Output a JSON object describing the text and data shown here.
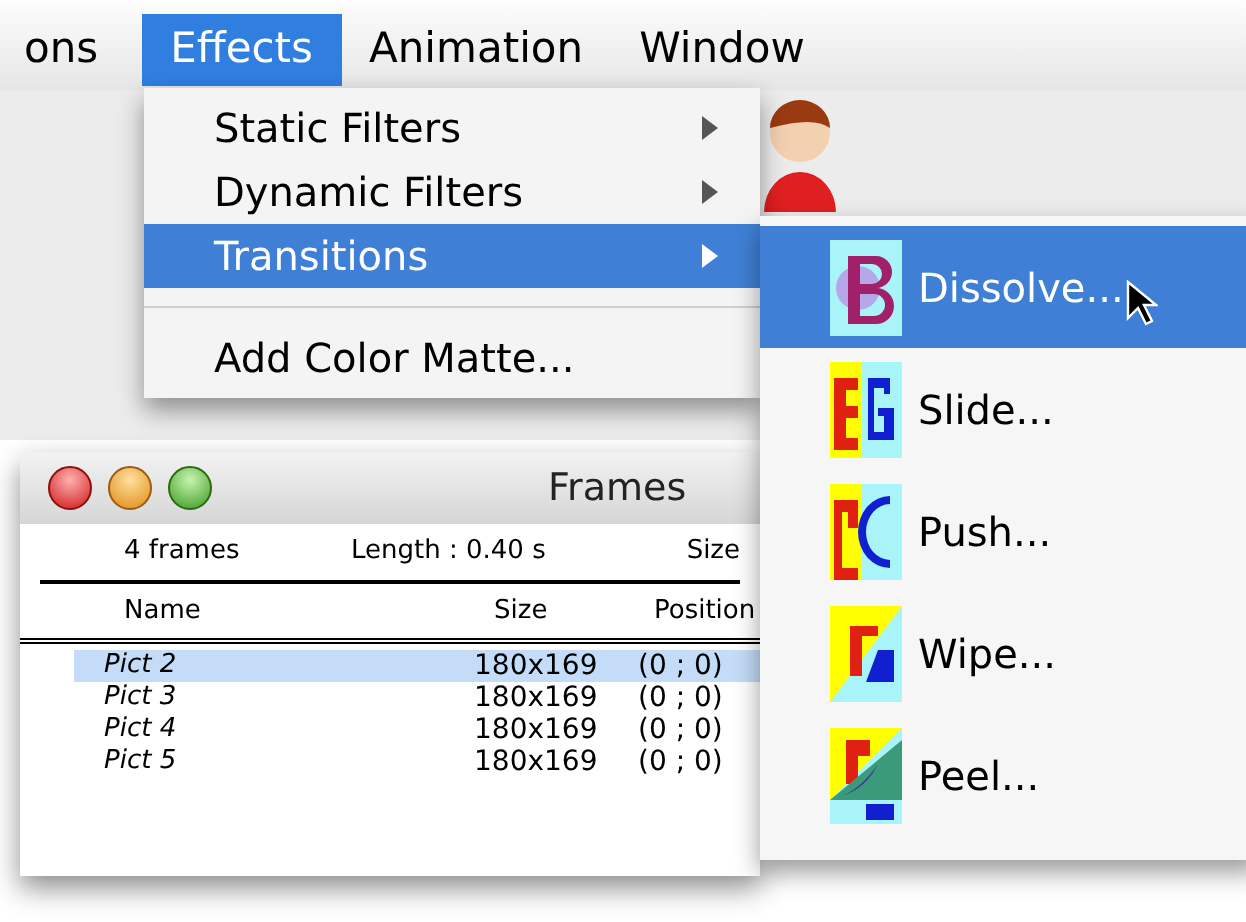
{
  "menu_bar": {
    "items": [
      {
        "label": "ons",
        "selected": false
      },
      {
        "label": "Effects",
        "selected": true
      },
      {
        "label": "Animation",
        "selected": false
      },
      {
        "label": "Window",
        "selected": false
      }
    ]
  },
  "effects_menu": {
    "items": [
      {
        "label": "Static Filters",
        "submenu": true,
        "selected": false,
        "separator_before": false
      },
      {
        "label": "Dynamic Filters",
        "submenu": true,
        "selected": false,
        "separator_before": false
      },
      {
        "label": "Transitions",
        "submenu": true,
        "selected": true,
        "separator_before": false
      },
      {
        "label": "Add Color Matte...",
        "submenu": false,
        "selected": false,
        "separator_before": true
      }
    ]
  },
  "transitions_menu": {
    "items": [
      {
        "label": "Dissolve...",
        "kind": "dissolve",
        "selected": true
      },
      {
        "label": "Slide...",
        "kind": "slide",
        "selected": false
      },
      {
        "label": "Push...",
        "kind": "push",
        "selected": false
      },
      {
        "label": "Wipe...",
        "kind": "wipe",
        "selected": false
      },
      {
        "label": "Peel...",
        "kind": "peel",
        "selected": false
      }
    ]
  },
  "frames_window": {
    "title": "Frames",
    "info": [
      "4 frames",
      "Length : 0.40 s",
      "Size"
    ],
    "columns": [
      "Name",
      "Size",
      "Position"
    ],
    "rows": [
      {
        "name": "Pict 2",
        "size": "180x169",
        "position": "(0 ; 0)",
        "selected": true
      },
      {
        "name": "Pict 3",
        "size": "180x169",
        "position": "(0 ; 0)",
        "selected": false
      },
      {
        "name": "Pict 4",
        "size": "180x169",
        "position": "(0 ; 0)",
        "selected": false
      },
      {
        "name": "Pict 5",
        "size": "180x169",
        "position": "(0 ; 0)",
        "selected": false
      }
    ]
  }
}
